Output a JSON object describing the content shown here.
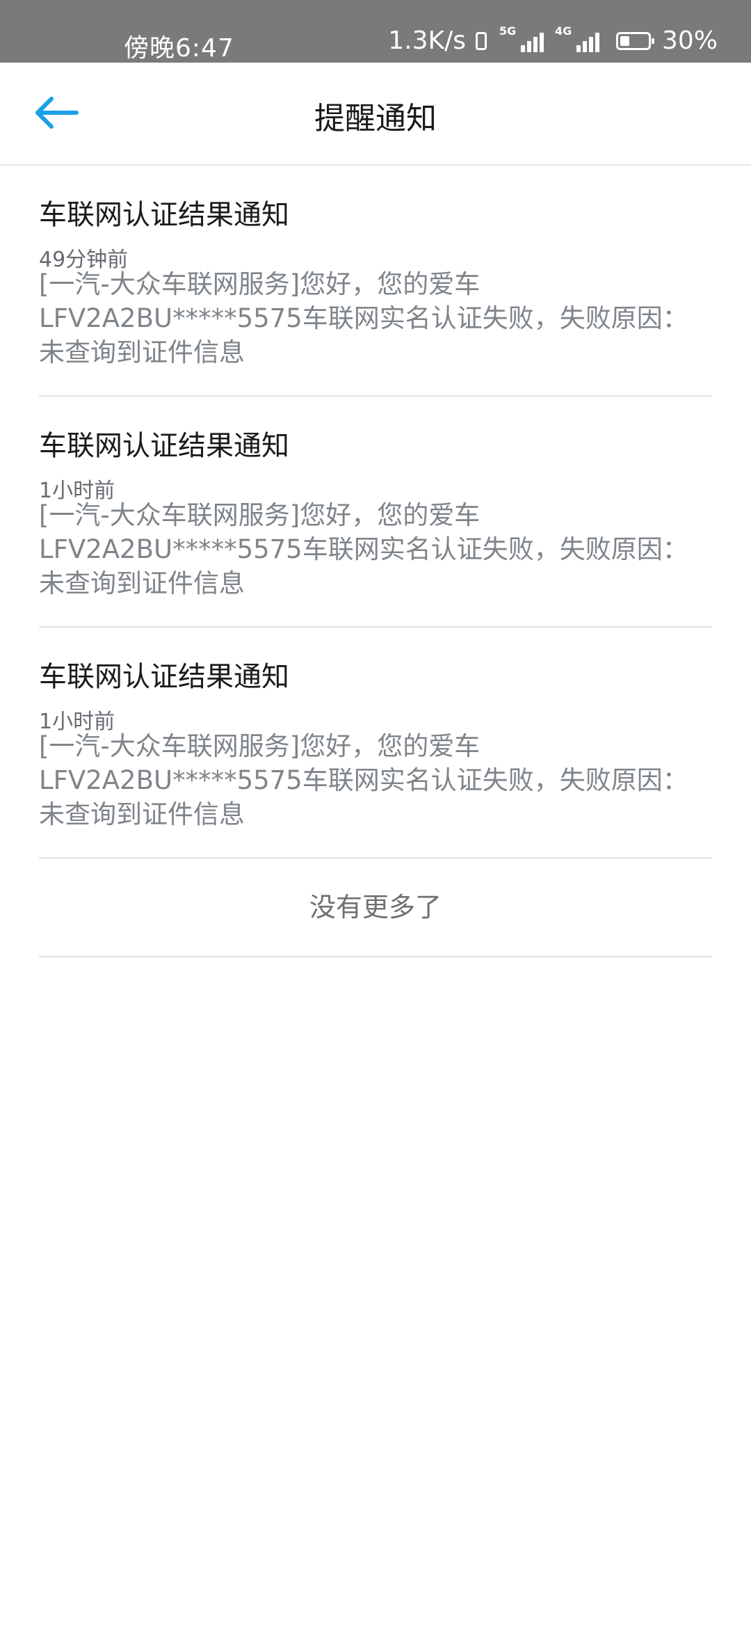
{
  "status_bar": {
    "time": "傍晚6:47",
    "net_speed": "1.3K/s",
    "sim1_label": "5G",
    "sim2_label": "4G",
    "battery": "30%"
  },
  "header": {
    "title": "提醒通知",
    "back_icon": "arrow-left-icon",
    "accent_color": "#1aa0e6"
  },
  "notices": [
    {
      "title": "车联网认证结果通知",
      "time": "49分钟前",
      "body_lines": [
        "[一汽-大众车联网服务]您好，您的爱车",
        "LFV2A2BU*****5575车联网实名认证失败，失败原因：",
        "未查询到证件信息"
      ]
    },
    {
      "title": "车联网认证结果通知",
      "time": "1小时前",
      "body_lines": [
        "[一汽-大众车联网服务]您好，您的爱车",
        "LFV2A2BU*****5575车联网实名认证失败，失败原因：",
        "未查询到证件信息"
      ]
    },
    {
      "title": "车联网认证结果通知",
      "time": "1小时前",
      "body_lines": [
        "[一汽-大众车联网服务]您好，您的爱车",
        "LFV2A2BU*****5575车联网实名认证失败，失败原因：",
        "未查询到证件信息"
      ]
    }
  ],
  "footer": {
    "no_more": "没有更多了"
  }
}
